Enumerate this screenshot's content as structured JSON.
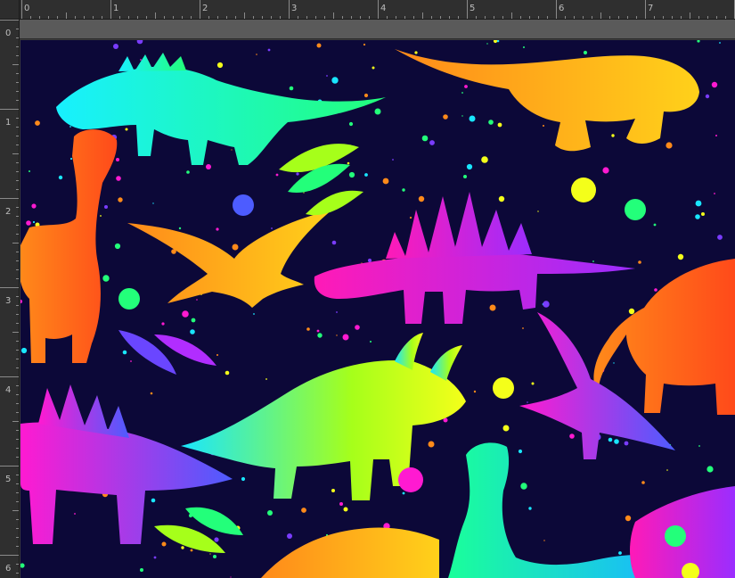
{
  "ruler": {
    "top_labels": [
      "0",
      "1",
      "2",
      "3",
      "4",
      "5",
      "6",
      "7"
    ],
    "left_labels": [
      "0",
      "1",
      "2",
      "3",
      "4",
      "5",
      "6"
    ]
  },
  "canvas": {
    "background": "#0c0838",
    "pattern": "neon gradient dinosaur silhouettes with paint splatter and leaves"
  },
  "colors": {
    "orange": "#ff6a1a",
    "yellow": "#f4ff1a",
    "cyan": "#19e6ff",
    "magenta": "#ff1ad1",
    "purple": "#7a3cff",
    "green": "#23ff7a",
    "navy": "#0c0838"
  },
  "icons": [
    "dinosaur-silhouette",
    "leaf-sprig",
    "paint-splatter",
    "ruler-guide"
  ]
}
